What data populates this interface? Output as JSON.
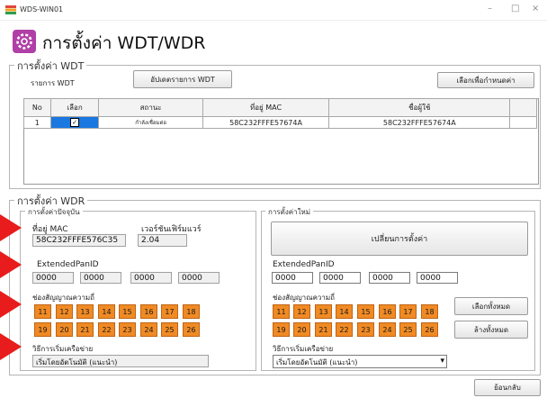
{
  "window": {
    "title": "WDS-WIN01",
    "minimize": "–",
    "maximize": "□",
    "close": "×"
  },
  "page_title": "การตั้งค่า WDT/WDR",
  "wdt": {
    "legend": "การตั้งค่า WDT",
    "list_label": "รายการ WDT",
    "update_button": "อัปเดตรายการ WDT",
    "select_config_button": "เลือกเพื่อกำหนดค่า",
    "columns": [
      "No",
      "เลือก",
      "สถานะ",
      "ที่อยู่ MAC",
      "ชื่อผู้ใช้"
    ],
    "rows": [
      {
        "no": "1",
        "checked": "✓",
        "status": "กำลังเชื่อมต่อ",
        "mac": "58C232FFFE57674A",
        "user": "58C232FFFE57674A"
      }
    ]
  },
  "wdr": {
    "legend": "การตั้งค่า WDR",
    "current": {
      "legend": "การตั้งค่าปัจจุบัน",
      "mac_label": "ที่อยู่ MAC",
      "mac_value": "58C232FFFE576C35",
      "fw_label": "เวอร์ชันเฟิร์มแวร์",
      "fw_value": "2.04",
      "panid_label": "ExtendedPanID",
      "panid": [
        "0000",
        "0000",
        "0000",
        "0000"
      ],
      "channel_label": "ช่องสัญญาณความถี่",
      "channels_row1": [
        "11",
        "12",
        "13",
        "14",
        "15",
        "16",
        "17",
        "18"
      ],
      "channels_row2": [
        "19",
        "20",
        "21",
        "22",
        "23",
        "24",
        "25",
        "26"
      ],
      "join_label": "วิธีการเริ่มเครือข่าย",
      "join_value": "เริ่มโดยอัตโนมัติ (แนะนำ)"
    },
    "new": {
      "legend": "การตั้งค่าใหม่",
      "change_button": "เปลี่ยนการตั้งค่า",
      "panid_label": "ExtendedPanID",
      "panid": [
        "0000",
        "0000",
        "0000",
        "0000"
      ],
      "channel_label": "ช่องสัญญาณความถี่",
      "channels_row1": [
        "11",
        "12",
        "13",
        "14",
        "15",
        "16",
        "17",
        "18"
      ],
      "channels_row2": [
        "19",
        "20",
        "21",
        "22",
        "23",
        "24",
        "25",
        "26"
      ],
      "select_all_button": "เลือกทั้งหมด",
      "clear_all_button": "ล้างทั้งหมด",
      "join_label": "วิธีการเริ่มเครือข่าย",
      "join_value": "เริ่มโดยอัตโนมัติ (แนะนำ)",
      "dropdown_arrow": "▾"
    }
  },
  "back_button": "ย้อนกลับ",
  "colors": {
    "tile": "#f08a24",
    "arrow": "#e81c1c",
    "checkbox_cell": "#1a78e0"
  }
}
